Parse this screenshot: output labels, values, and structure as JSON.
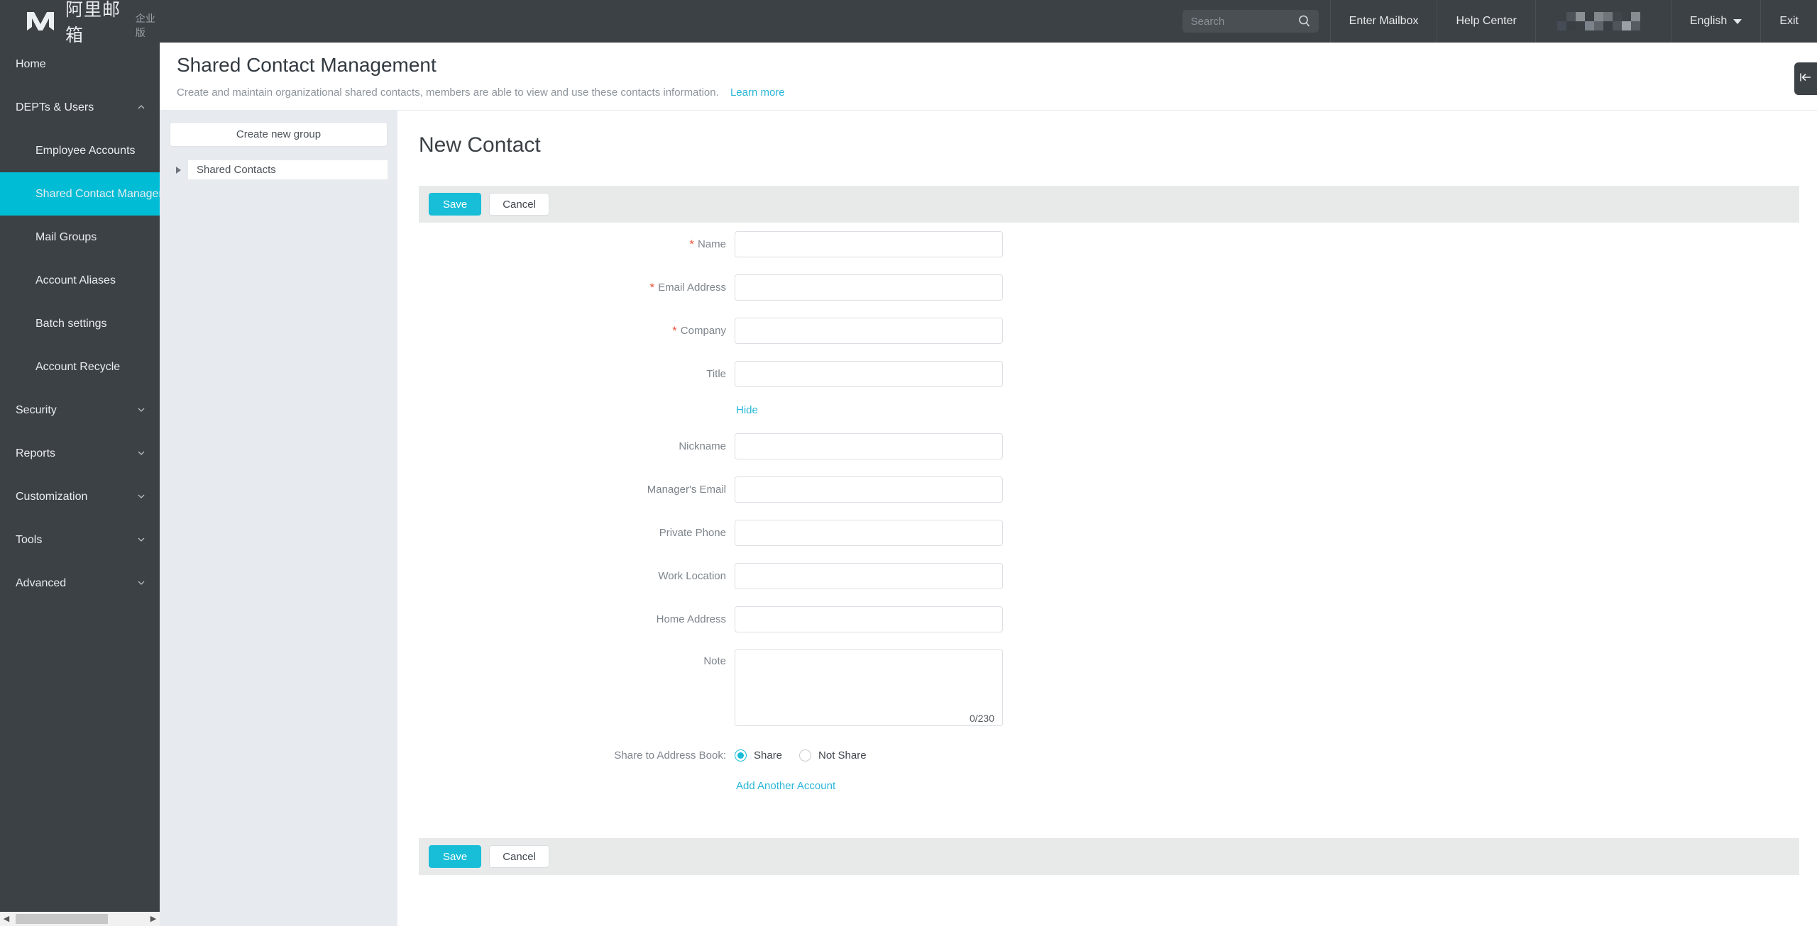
{
  "topbar": {
    "brand_cn": "阿里邮箱",
    "brand_sub": "企业版",
    "search": {
      "value": "",
      "placeholder": "Search"
    },
    "items": [
      {
        "label": "Enter Mailbox",
        "name": "enter-mailbox"
      },
      {
        "label": "Help Center",
        "name": "help-center"
      }
    ],
    "account_redacted": "",
    "language": "English",
    "exit": "Exit"
  },
  "sidebar": {
    "items": [
      {
        "label": "Home",
        "level": "top",
        "chevron": "none",
        "active": false
      },
      {
        "label": "DEPTs & Users",
        "level": "top",
        "chevron": "up",
        "active": false
      },
      {
        "label": "Employee Accounts",
        "level": "sub",
        "chevron": "none",
        "active": false
      },
      {
        "label": "Shared Contact Management",
        "level": "sub",
        "chevron": "none",
        "active": true
      },
      {
        "label": "Mail Groups",
        "level": "sub",
        "chevron": "none",
        "active": false
      },
      {
        "label": "Account Aliases",
        "level": "sub",
        "chevron": "none",
        "active": false
      },
      {
        "label": "Batch settings",
        "level": "sub",
        "chevron": "none",
        "active": false
      },
      {
        "label": "Account Recycle",
        "level": "sub",
        "chevron": "none",
        "active": false
      },
      {
        "label": "Security",
        "level": "top",
        "chevron": "down",
        "active": false
      },
      {
        "label": "Reports",
        "level": "top",
        "chevron": "down",
        "active": false
      },
      {
        "label": "Customization",
        "level": "top",
        "chevron": "down",
        "active": false
      },
      {
        "label": "Tools",
        "level": "top",
        "chevron": "down",
        "active": false
      },
      {
        "label": "Advanced",
        "level": "top",
        "chevron": "down",
        "active": false
      }
    ]
  },
  "page": {
    "title": "Shared Contact Management",
    "description": "Create and maintain organizational shared contacts, members are able to view and use these contacts information.",
    "learn_more": "Learn more"
  },
  "group_panel": {
    "create_button": "Create new group",
    "tree_item": "Shared Contacts"
  },
  "form": {
    "heading": "New Contact",
    "save_label": "Save",
    "cancel_label": "Cancel",
    "hide_link": "Hide",
    "fields": [
      {
        "label": "Name",
        "required": true,
        "value": "",
        "placeholder": "",
        "name": "name"
      },
      {
        "label": "Email Address",
        "required": true,
        "value": "",
        "placeholder": "",
        "name": "email-address"
      },
      {
        "label": "Company",
        "required": true,
        "value": "",
        "placeholder": "",
        "name": "company"
      },
      {
        "label": "Title",
        "required": false,
        "value": "",
        "placeholder": "",
        "name": "title"
      }
    ],
    "extra_fields": [
      {
        "label": "Nickname",
        "required": false,
        "value": "",
        "placeholder": "",
        "name": "nickname"
      },
      {
        "label": "Manager's Email",
        "required": false,
        "value": "",
        "placeholder": "",
        "name": "managers-email"
      },
      {
        "label": "Private Phone",
        "required": false,
        "value": "",
        "placeholder": "",
        "name": "private-phone"
      },
      {
        "label": "Work Location",
        "required": false,
        "value": "",
        "placeholder": "",
        "name": "work-location"
      },
      {
        "label": "Home Address",
        "required": false,
        "value": "",
        "placeholder": "",
        "name": "home-address"
      }
    ],
    "note": {
      "label": "Note",
      "value": "",
      "counter": "0/230"
    },
    "share": {
      "label": "Share to Address Book:",
      "options": [
        {
          "label": "Share",
          "selected": true
        },
        {
          "label": "Not Share",
          "selected": false
        }
      ]
    },
    "add_another": "Add Another Account"
  },
  "colors": {
    "accent": "#18bdd8",
    "sidebar_bg": "#3c4145",
    "active_item": "#00bcd4",
    "required": "#e8553a",
    "link": "#29b6d8"
  }
}
